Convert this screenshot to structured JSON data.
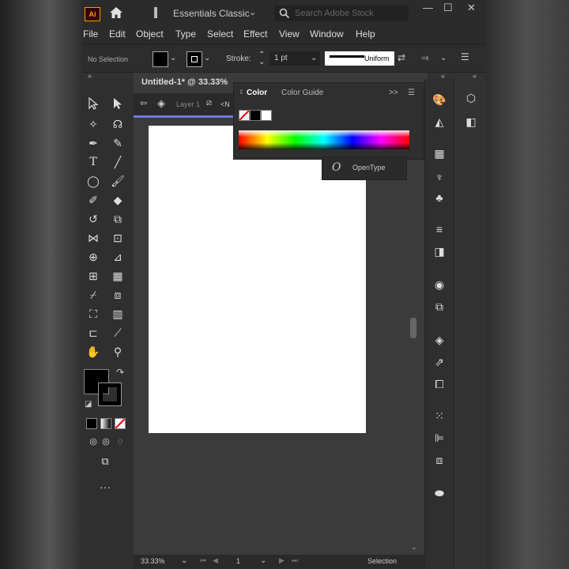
{
  "app": {
    "logo": "Ai",
    "workspace": "Essentials Classic",
    "search_placeholder": "Search Adobe Stock",
    "window_controls": [
      "—",
      "☐",
      "✕"
    ]
  },
  "menu": [
    "File",
    "Edit",
    "Object",
    "Type",
    "Select",
    "Effect",
    "View",
    "Window",
    "Help"
  ],
  "control_bar": {
    "selection_status": "No Selection",
    "stroke_label": "Stroke:",
    "stroke_value": "1 pt",
    "profile_label": "Uniform"
  },
  "document": {
    "tab_title": "Untitled-1* @ 33.33%",
    "layer_label": "Layer 1",
    "layer_extra": "<N",
    "zoom": "33.33%",
    "page": "1",
    "status": "Selection"
  },
  "color_panel": {
    "tab_color": "Color",
    "tab_guide": "Color Guide",
    "expand_icon": ">>"
  },
  "opentype_panel": {
    "label": "OpenType"
  },
  "colors": {
    "ui_bg": "#323232",
    "artboard": "#ffffff",
    "layer_accent": "#6b7bdc",
    "ai_logo": "#ff9a00"
  }
}
